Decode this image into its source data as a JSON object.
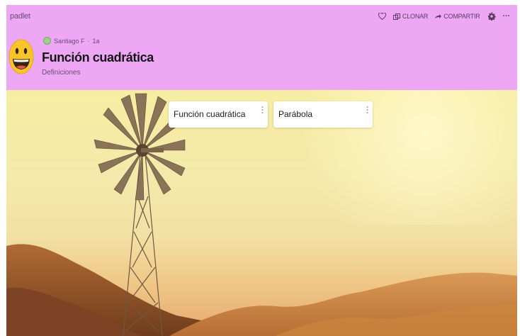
{
  "header": {
    "brand": "padlet",
    "author": "Santiago F",
    "meta_separator": "·",
    "age": "1a",
    "title": "Función cuadrática",
    "subtitle": "Definiciones",
    "actions": [
      {
        "icon": "heart-icon",
        "label": ""
      },
      {
        "icon": "clone-icon",
        "label": "CLONAR"
      },
      {
        "icon": "share-icon",
        "label": "COMPARTIR"
      },
      {
        "icon": "gear-icon",
        "label": ""
      },
      {
        "icon": "more-horizontal-icon",
        "label": "···"
      }
    ]
  },
  "cards": [
    {
      "label": "Función cuadrática"
    },
    {
      "label": "Parábola"
    }
  ],
  "colors": {
    "header_bg": "#eda7f5",
    "title": "#151515",
    "sky": "#f7eda2",
    "hills": "#9a5f2f"
  }
}
